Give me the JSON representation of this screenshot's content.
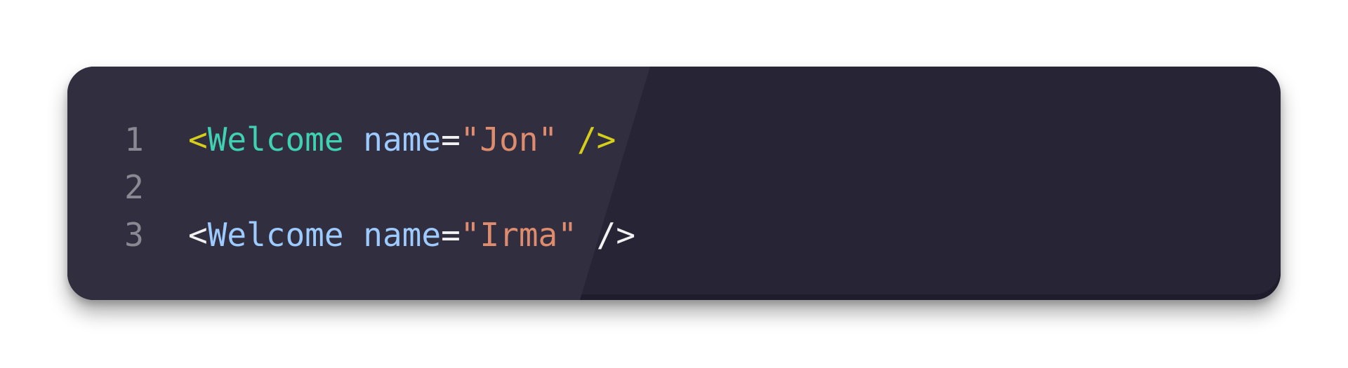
{
  "editor": {
    "colors": {
      "background": "#262435",
      "line_number": "#8a8893",
      "bracket_highlight": "#d6cf1a",
      "component_highlight": "#3fd1b1",
      "component": "#9ecbff",
      "attribute": "#9ecbff",
      "equals": "#f2f2f2",
      "string": "#df8c6e",
      "plain": "#f2f2f2"
    },
    "lines": [
      {
        "number": "1",
        "tokens": [
          {
            "text": "<",
            "color": "#d6cf1a"
          },
          {
            "text": "Welcome",
            "color": "#3fd1b1"
          },
          {
            "text": " ",
            "color": "#f2f2f2"
          },
          {
            "text": "name",
            "color": "#9ecbff"
          },
          {
            "text": "=",
            "color": "#f2f2f2"
          },
          {
            "text": "\"Jon\"",
            "color": "#df8c6e"
          },
          {
            "text": " ",
            "color": "#f2f2f2"
          },
          {
            "text": "/>",
            "color": "#d6cf1a"
          }
        ]
      },
      {
        "number": "2",
        "tokens": []
      },
      {
        "number": "3",
        "tokens": [
          {
            "text": "<",
            "color": "#f2f2f2"
          },
          {
            "text": "Welcome",
            "color": "#9ecbff"
          },
          {
            "text": " ",
            "color": "#f2f2f2"
          },
          {
            "text": "name",
            "color": "#9ecbff"
          },
          {
            "text": "=",
            "color": "#f2f2f2"
          },
          {
            "text": "\"Irma\"",
            "color": "#df8c6e"
          },
          {
            "text": " ",
            "color": "#f2f2f2"
          },
          {
            "text": "/>",
            "color": "#f2f2f2"
          }
        ]
      }
    ]
  }
}
